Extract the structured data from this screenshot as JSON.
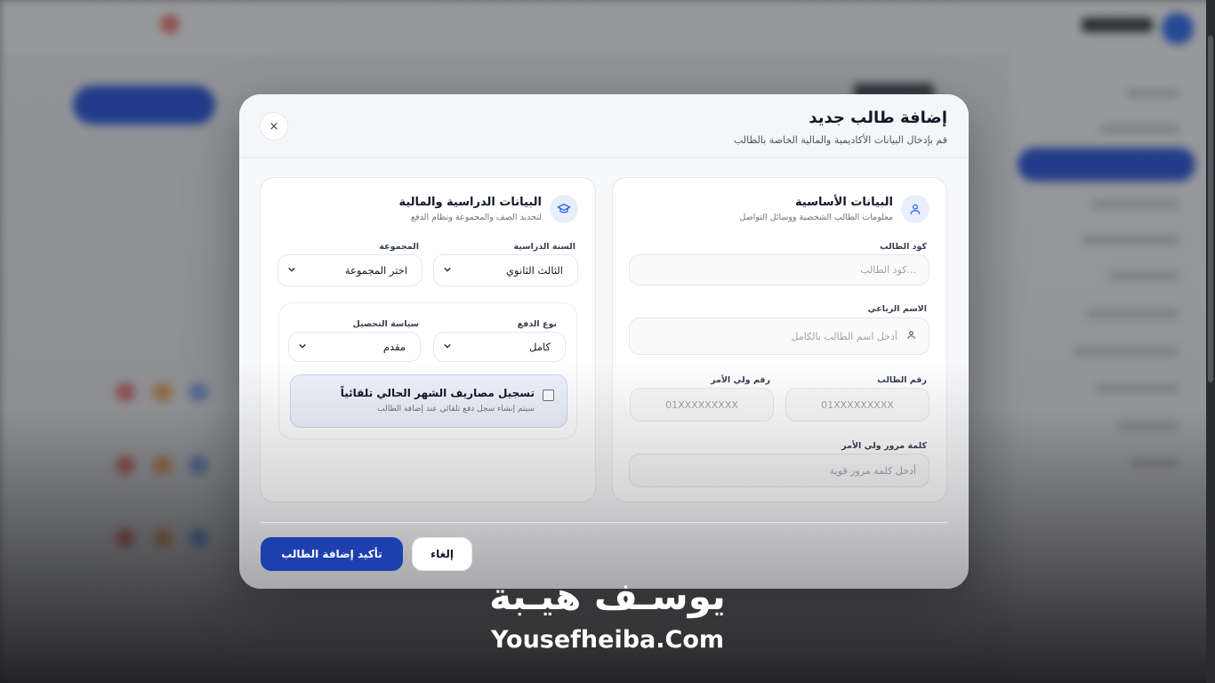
{
  "modal": {
    "title": "إضافة طالب جديد",
    "subtitle": "قم بإدخال البيانات الأكاديمية والمالية الخاصة بالطالب",
    "close_symbol": "×"
  },
  "basic_section": {
    "title": "البيانات الأساسية",
    "description": "معلومات الطالب الشخصية ووسائل التواصل",
    "icon": "user-icon",
    "student_code": {
      "label": "كود الطالب",
      "placeholder": "...كود الطالب"
    },
    "full_name": {
      "label": "الاسم الرباعي",
      "placeholder": "أدخل اسم الطالب بالكامل"
    },
    "student_phone": {
      "label": "رقم الطالب",
      "placeholder": "01XXXXXXXXX"
    },
    "guardian_phone": {
      "label": "رقم ولي الأمر",
      "placeholder": "01XXXXXXXXX"
    },
    "guardian_password": {
      "label": "كلمة مرور ولي الأمر",
      "placeholder": "أدخل كلمة مرور قوية"
    }
  },
  "academic_section": {
    "title": "البيانات الدراسية والمالية",
    "description": "لتحديد الصف والمجموعة ونظام الدفع",
    "icon": "graduation-cap-icon",
    "school_year": {
      "label": "السنة الدراسية",
      "value": "الثالث الثانوي"
    },
    "group": {
      "label": "المجموعة",
      "value": "اختر المجموعة"
    },
    "payment_type": {
      "label": "نوع الدفع",
      "value": "كامل"
    },
    "collection_policy": {
      "label": "سياسة التحصيل",
      "value": "مقدم"
    },
    "auto_charge": {
      "title": "تسجيل مصاريف الشهر الحالي تلقائياً",
      "description": "سيتم إنشاء سجل دفع تلقائي عند إضافة الطالب",
      "checked": false
    }
  },
  "footer": {
    "confirm_label": "تأكيد إضافة الطالب",
    "cancel_label": "إلغاء"
  },
  "watermark": {
    "arabic": "يوسـف هيـبة",
    "latin": "Yousefheiba.Com"
  },
  "colors": {
    "primary": "#1e40af",
    "accent_light": "#e8eefc",
    "checkbox_card_bg": "#eef2fc"
  }
}
